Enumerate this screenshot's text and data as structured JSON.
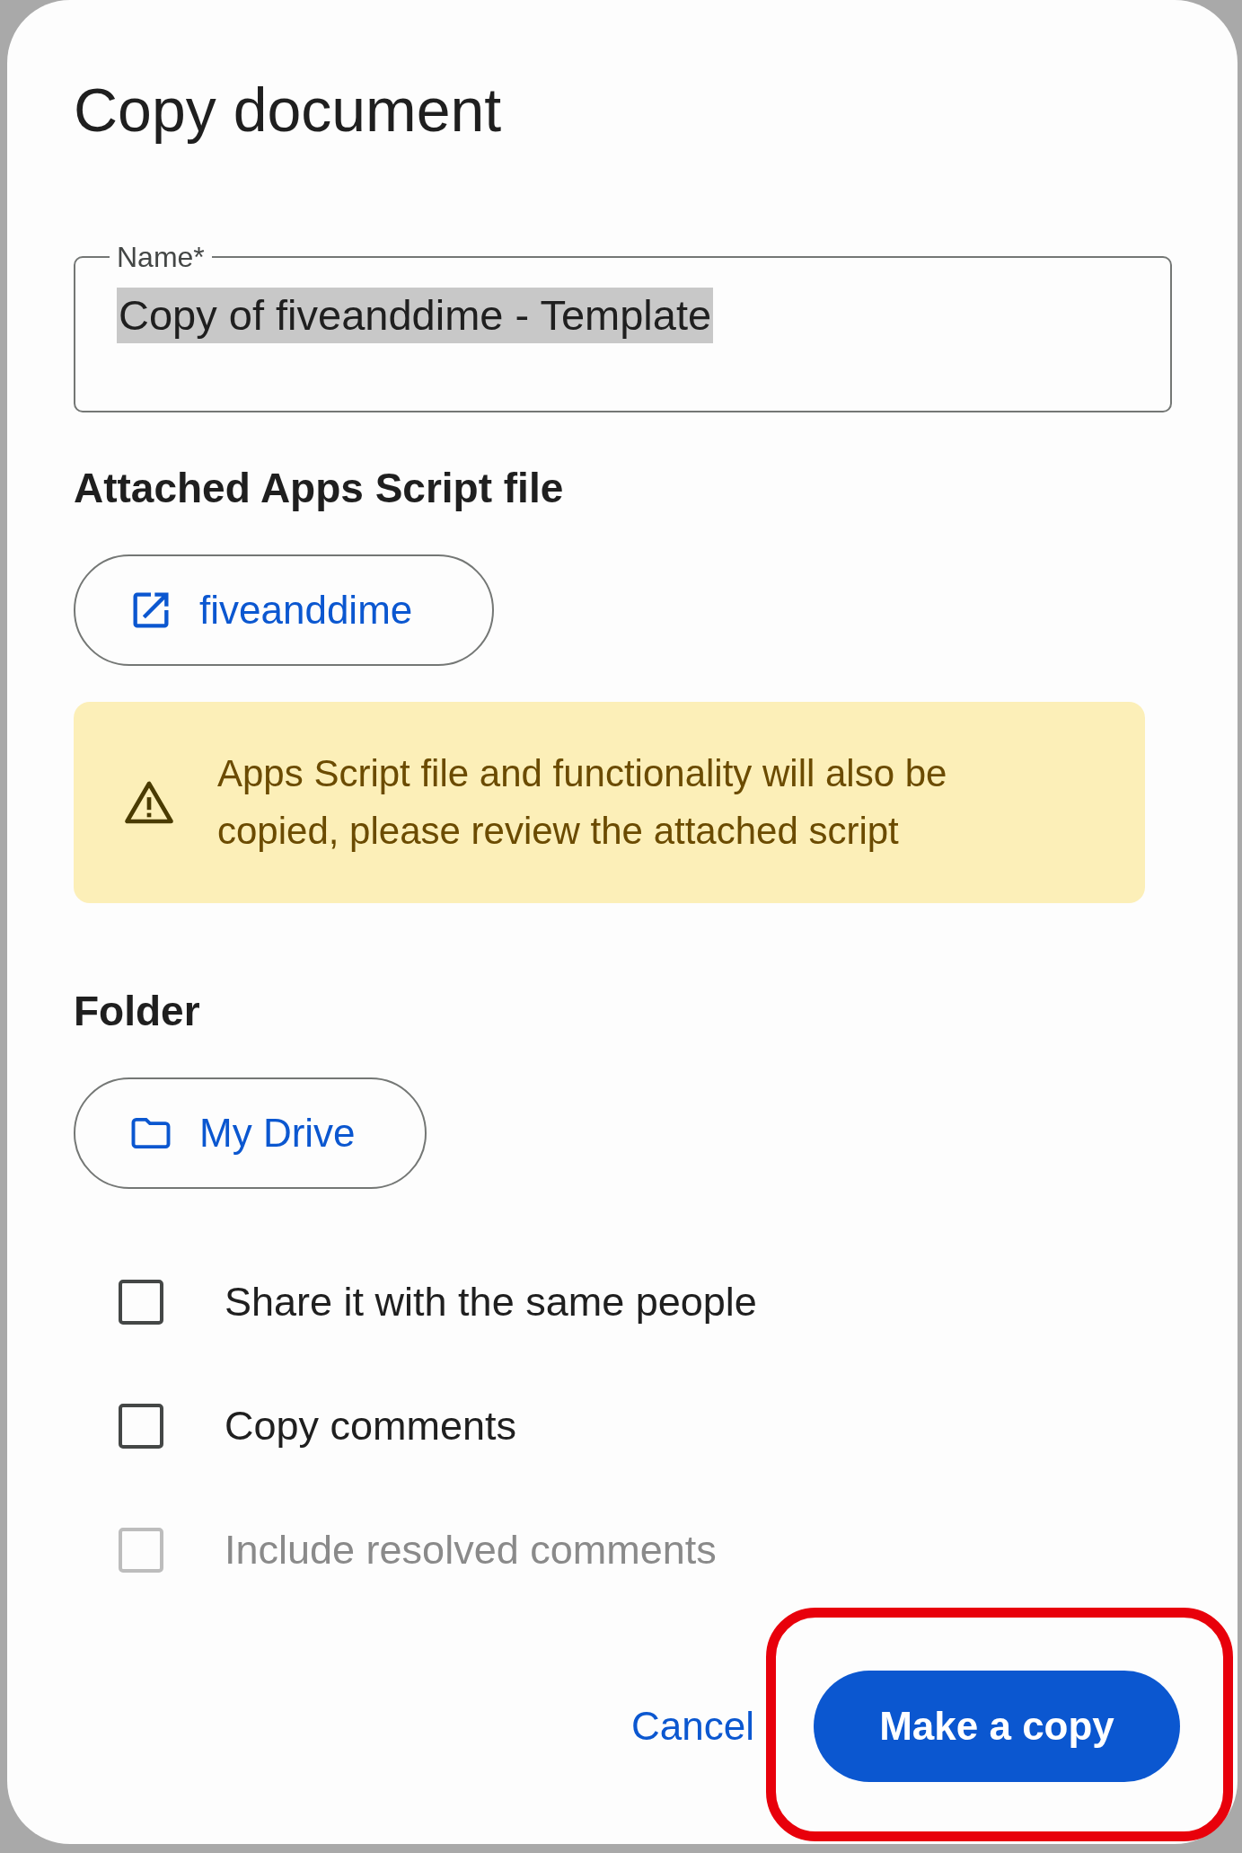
{
  "dialog": {
    "title": "Copy document"
  },
  "name_field": {
    "label": "Name*",
    "value": "Copy of fiveanddime - Template",
    "text_selected": true
  },
  "script_section": {
    "heading": "Attached Apps Script file",
    "file_button": "fiveanddime"
  },
  "warning": {
    "text": "Apps Script file and functionality will also be copied, please review the attached script"
  },
  "folder_section": {
    "heading": "Folder",
    "folder_button": "My Drive"
  },
  "options": [
    {
      "label": "Share it with the same people",
      "checked": false,
      "disabled": false
    },
    {
      "label": "Copy comments",
      "checked": false,
      "disabled": false
    },
    {
      "label": "Include resolved comments",
      "checked": false,
      "disabled": true
    }
  ],
  "buttons": {
    "cancel": "Cancel",
    "confirm": "Make a copy",
    "confirm_highlighted": true
  }
}
